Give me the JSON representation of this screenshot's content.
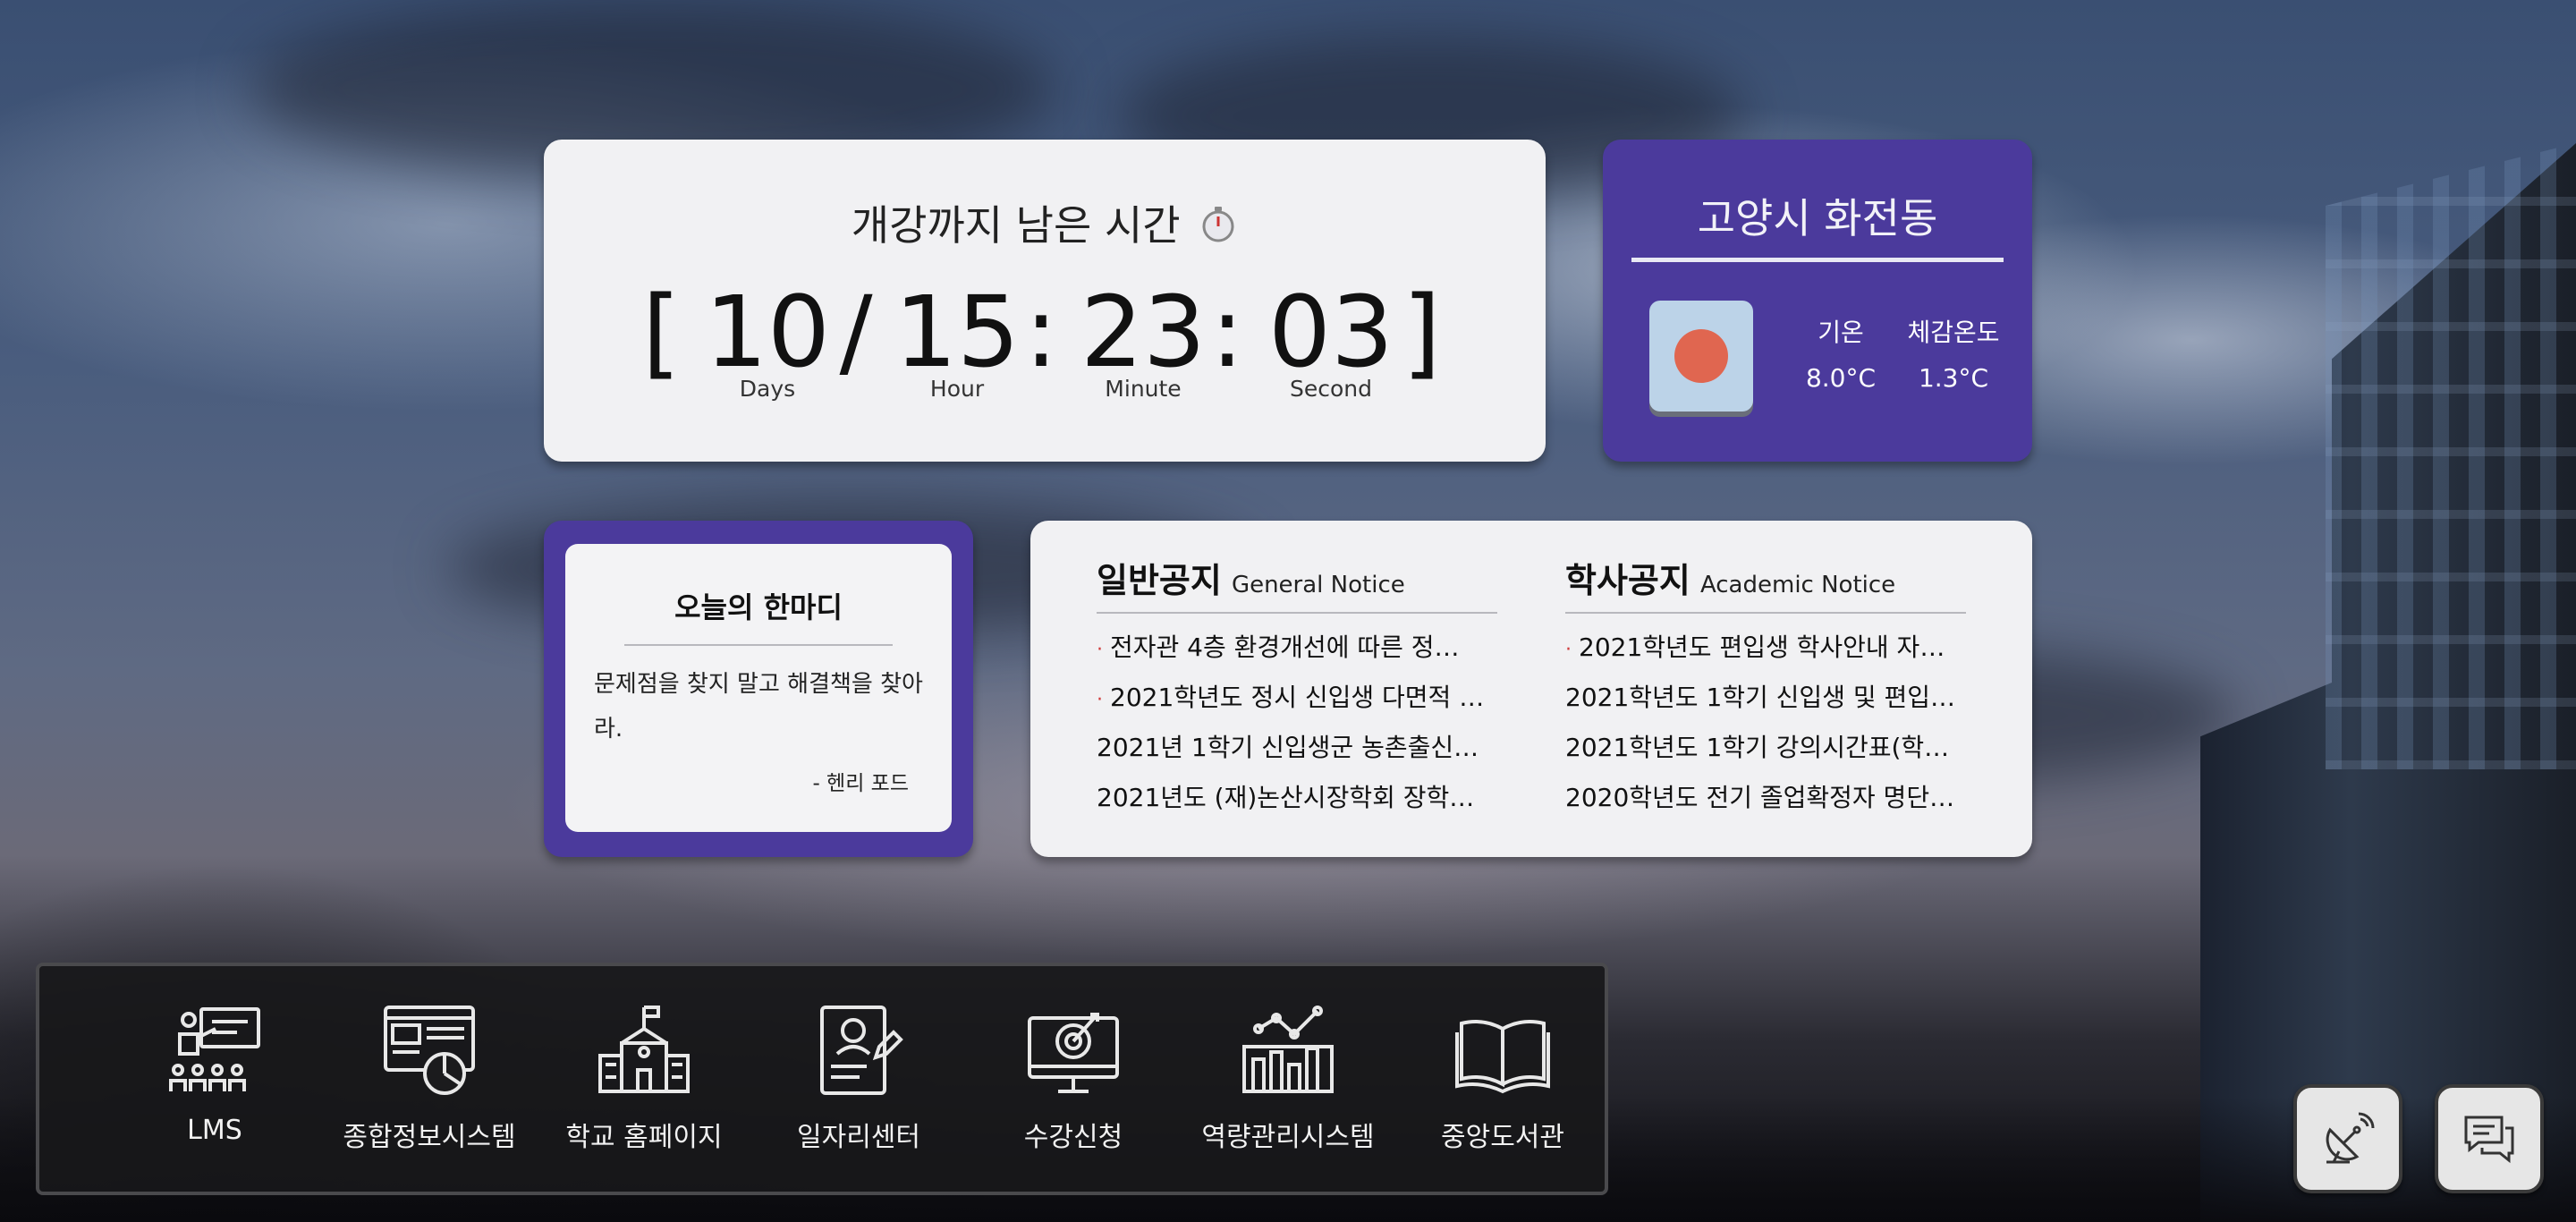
{
  "countdown": {
    "title": "개강까지 남은 시간",
    "title_icon": "stopwatch-icon",
    "open_bracket": "[",
    "close_bracket": "]",
    "days": "10",
    "hours": "15",
    "minutes": "23",
    "seconds": "03",
    "sep_days": "/",
    "sep_time": ":",
    "labels": {
      "days": "Days",
      "hours": "Hour",
      "minutes": "Minute",
      "seconds": "Second"
    }
  },
  "weather": {
    "city": "고양시 화전동",
    "icon": "sun-icon",
    "temp_label": "기온",
    "feels_label": "체감온도",
    "temp": "8.0°C",
    "feels": "1.3°C"
  },
  "quote": {
    "title": "오늘의 한마디",
    "text": "문제점을 찾지 말고 해결책을 찾아라.",
    "author": "- 헨리 포드"
  },
  "notices": {
    "general": {
      "title": "일반공지",
      "subtitle": "General Notice",
      "items": [
        {
          "text": "전자관 4층 환경개선에 따른 정…",
          "new": true
        },
        {
          "text": "2021학년도 정시 신입생 다면적 …",
          "new": true
        },
        {
          "text": "2021년 1학기 신입생군 농촌출신…",
          "new": false
        },
        {
          "text": "2021년도 (재)논산시장학회 장학…",
          "new": false
        }
      ]
    },
    "academic": {
      "title": "학사공지",
      "subtitle": "Academic Notice",
      "items": [
        {
          "text": "2021학년도 편입생 학사안내 자…",
          "new": true
        },
        {
          "text": "2021학년도 1학기 신입생 및 편입…",
          "new": false
        },
        {
          "text": "2021학년도 1학기 강의시간표(학…",
          "new": false
        },
        {
          "text": "2020학년도 전기 졸업확정자 명단…",
          "new": false
        }
      ]
    },
    "bullet": "·"
  },
  "dock": [
    {
      "label": "LMS",
      "icon": "lecture-icon"
    },
    {
      "label": "종합정보시스템",
      "icon": "dashboard-icon"
    },
    {
      "label": "학교 홈페이지",
      "icon": "school-icon"
    },
    {
      "label": "일자리센터",
      "icon": "resume-icon"
    },
    {
      "label": "수강신청",
      "icon": "target-monitor-icon"
    },
    {
      "label": "역량관리시스템",
      "icon": "bar-chart-icon"
    },
    {
      "label": "중앙도서관",
      "icon": "book-icon"
    }
  ],
  "fabs": [
    {
      "icon": "satellite-dish-icon"
    },
    {
      "icon": "chat-icon"
    }
  ],
  "colors": {
    "accent": "#4b3a9c",
    "card": "#f1f1f3",
    "new_dot": "#d03a3a",
    "sun": "#e06650",
    "dock_bg": "#18181a"
  }
}
